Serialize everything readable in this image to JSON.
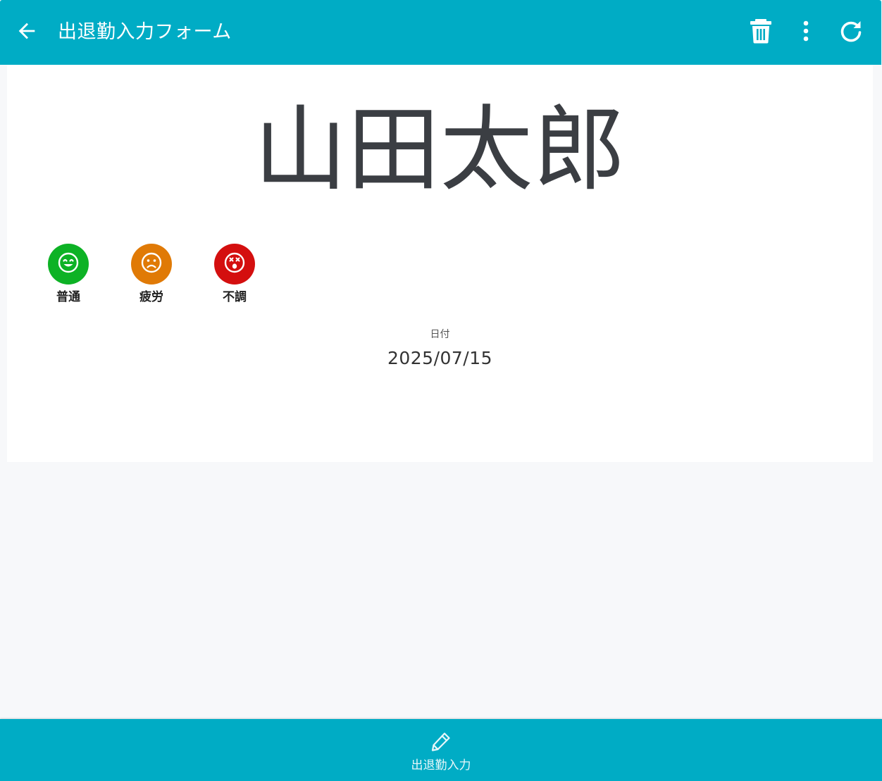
{
  "colors": {
    "primary": "#00acc5",
    "card_bg": "#ffffff",
    "page_bg": "#f7f8fa",
    "condition_normal": "#0db225",
    "condition_tired": "#e07a06",
    "condition_ill": "#d40f0f"
  },
  "header": {
    "title": "出退勤入力フォーム",
    "back_icon": "arrow-left-icon",
    "actions": [
      {
        "name": "delete",
        "icon": "trash-icon"
      },
      {
        "name": "more",
        "icon": "more-vertical-icon"
      },
      {
        "name": "refresh",
        "icon": "refresh-icon"
      }
    ]
  },
  "person": {
    "name": "山田太郎"
  },
  "conditions": [
    {
      "label": "普通",
      "icon": "smile-icon",
      "color": "#0db225"
    },
    {
      "label": "疲労",
      "icon": "frown-icon",
      "color": "#e07a06"
    },
    {
      "label": "不調",
      "icon": "dizzy-icon",
      "color": "#d40f0f"
    }
  ],
  "date": {
    "label": "日付",
    "value": "2025/07/15"
  },
  "bottom_nav": {
    "items": [
      {
        "label": "出退勤入力",
        "icon": "pencil-icon"
      }
    ]
  }
}
